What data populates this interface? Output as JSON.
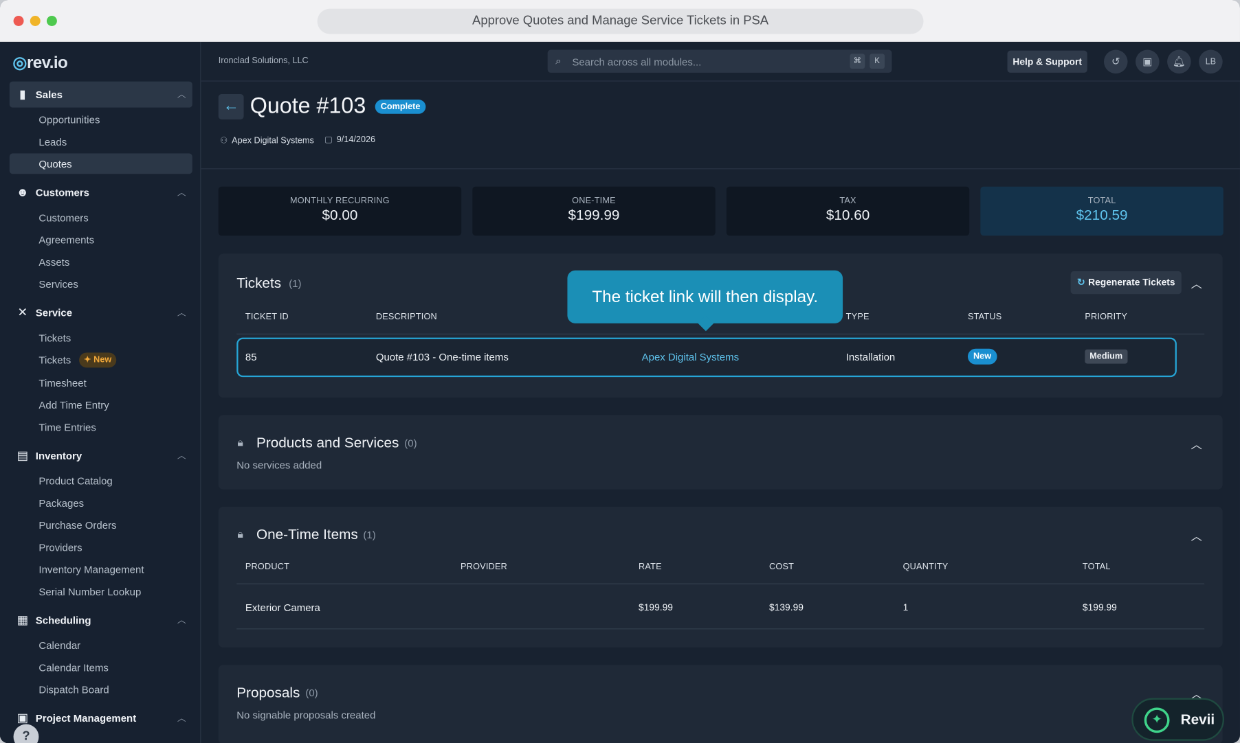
{
  "window": {
    "title": "Approve Quotes and Manage Service Tickets in PSA"
  },
  "brand": {
    "logo": "rev.io",
    "accent": "#5fc4ee"
  },
  "sidebar": {
    "sections": [
      {
        "label": "Sales",
        "icon": "bar-chart-icon",
        "items": [
          "Opportunities",
          "Leads",
          "Quotes"
        ]
      },
      {
        "label": "Customers",
        "icon": "people-icon",
        "items": [
          "Customers",
          "Agreements",
          "Assets",
          "Services"
        ]
      },
      {
        "label": "Service",
        "icon": "tools-icon",
        "items": [
          "Tickets",
          "Tickets",
          "Timesheet",
          "Add Time Entry",
          "Time Entries"
        ]
      },
      {
        "label": "Inventory",
        "icon": "archive-box-icon",
        "items": [
          "Product Catalog",
          "Packages",
          "Purchase Orders",
          "Providers",
          "Inventory Management",
          "Serial Number Lookup"
        ]
      },
      {
        "label": "Scheduling",
        "icon": "calendar-icon",
        "items": [
          "Calendar",
          "Calendar Items",
          "Dispatch Board"
        ]
      },
      {
        "label": "Project Management",
        "icon": "project-icon",
        "items": []
      }
    ],
    "active_item": "Quotes",
    "new_badge": "New",
    "help_label": "?"
  },
  "topbar": {
    "company": "Ironclad Solutions, LLC",
    "search_placeholder": "Search across all modules...",
    "search_keys": [
      "⌘",
      "K"
    ],
    "help_button": "Help & Support",
    "avatar_initials": "LB"
  },
  "quote": {
    "title": "Quote #103",
    "status": "Complete",
    "customer": "Apex Digital Systems",
    "date": "9/14/2026"
  },
  "stats": [
    {
      "label": "MONTHLY RECURRING",
      "value": "$0.00"
    },
    {
      "label": "ONE-TIME",
      "value": "$199.99"
    },
    {
      "label": "TAX",
      "value": "$10.60"
    },
    {
      "label": "TOTAL",
      "value": "$210.59"
    }
  ],
  "tickets": {
    "title": "Tickets",
    "count": "(1)",
    "regenerate_label": "Regenerate Tickets",
    "columns": [
      "TICKET ID",
      "DESCRIPTION",
      "TYPE",
      "STATUS",
      "PRIORITY"
    ],
    "row": {
      "id": "85",
      "description": "Quote #103 - One-time items",
      "customer": "Apex Digital Systems",
      "type": "Installation",
      "status": "New",
      "priority": "Medium"
    }
  },
  "tooltip": {
    "text": "The ticket link will then display."
  },
  "products": {
    "title": "Products and Services",
    "count": "(0)",
    "empty": "No services added"
  },
  "one_time": {
    "title": "One-Time Items",
    "count": "(1)",
    "columns": [
      "PRODUCT",
      "PROVIDER",
      "RATE",
      "COST",
      "QUANTITY",
      "TOTAL"
    ],
    "rows": [
      {
        "product": "Exterior Camera",
        "provider": "",
        "rate": "$199.99",
        "cost": "$139.99",
        "quantity": "1",
        "total": "$199.99"
      }
    ]
  },
  "proposals": {
    "title": "Proposals",
    "count": "(0)",
    "empty": "No signable proposals created"
  },
  "assistant": {
    "label": "Revii"
  }
}
